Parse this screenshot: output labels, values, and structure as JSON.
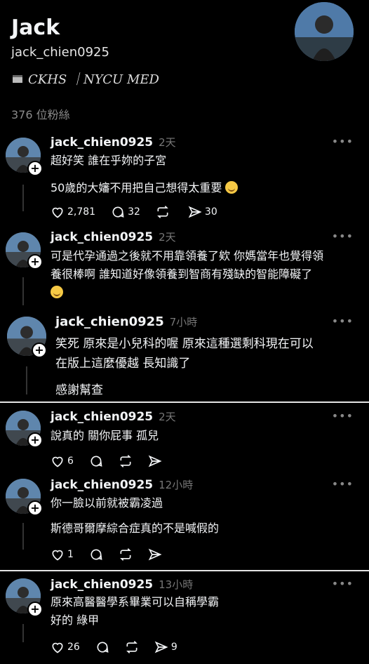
{
  "profile": {
    "display_name": "Jack",
    "handle": "jack_chien0925",
    "bio": "CKHS ｜NYCU MED",
    "followers": "376 位粉絲"
  },
  "posts": [
    {
      "username": "jack_chien0925",
      "time": "2天",
      "lines": [
        "超好笑 誰在乎妳的子宮",
        "50歲的大嬸不用把自己想得太重要"
      ],
      "likes": "2,781",
      "comments": "32",
      "reposts": "",
      "shares": "30"
    },
    {
      "username": "jack_chien0925",
      "time": "2天",
      "lines": [
        "可是代孕通過之後就不用靠領養了欸 你媽當年也覺得領",
        "養很棒啊 誰知道好像領養到智商有殘缺的智能障礙了"
      ]
    },
    {
      "username": "jack_chien0925",
      "time": "7小時",
      "lines": [
        "笑死 原來是小兒科的喔 原來這種選剩科現在可以",
        "在版上這麼優越 長知識了",
        "感謝幫查"
      ]
    },
    {
      "username": "jack_chien0925",
      "time": "2天",
      "lines": [
        "說真的 關你屁事 孤兒"
      ],
      "likes": "6"
    },
    {
      "username": "jack_chien0925",
      "time": "12小時",
      "lines": [
        "你一臉以前就被霸凌過",
        "斯德哥爾摩綜合症真的不是喊假的"
      ],
      "likes": "1"
    },
    {
      "username": "jack_chien0925",
      "time": "13小時",
      "lines": [
        "原來高醫醫學系畢業可以自稱學霸",
        "好的 綠甲"
      ],
      "likes": "26",
      "shares": "9"
    }
  ],
  "icons": {
    "more": "more-horizontal-icon",
    "like": "heart-icon",
    "comment": "comment-icon",
    "repost": "repost-icon",
    "share": "send-icon"
  },
  "colors": {
    "background": "#000000",
    "text": "#f3f5f7",
    "muted": "#777777"
  }
}
